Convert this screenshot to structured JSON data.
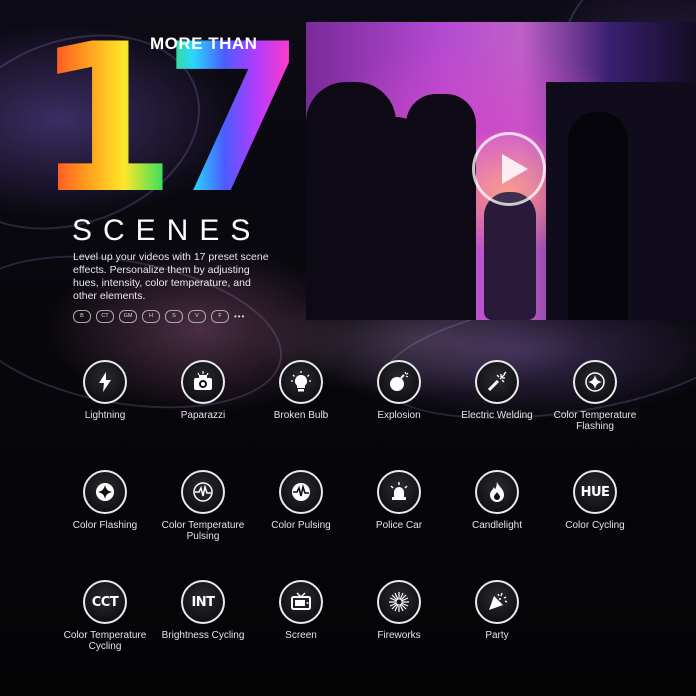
{
  "hero": {
    "more_than": "MORE THAN",
    "number": "17",
    "scenes": "SCENES",
    "description": "Level up your videos with 17 preset scene effects. Personalize them by adjusting hues, intensity, color temperature, and other elements."
  },
  "modes": [
    "B",
    "CT",
    "GM",
    "H",
    "S",
    "V",
    "F",
    "•••"
  ],
  "video": {
    "play_icon": "play-icon"
  },
  "effects": [
    {
      "label": "Lightning",
      "icon": "lightning-icon"
    },
    {
      "label": "Paparazzi",
      "icon": "camera-icon"
    },
    {
      "label": "Broken Bulb",
      "icon": "bulb-icon"
    },
    {
      "label": "Explosion",
      "icon": "bomb-icon"
    },
    {
      "label": "Electric Welding",
      "icon": "welding-icon"
    },
    {
      "label": "Color Temperature Flashing",
      "icon": "sparkle-icon"
    },
    {
      "label": "Color Flashing",
      "icon": "sparkle-filled-icon"
    },
    {
      "label": "Color Temperature Pulsing",
      "icon": "pulse-icon"
    },
    {
      "label": "Color Pulsing",
      "icon": "pulse-filled-icon"
    },
    {
      "label": "Police Car",
      "icon": "siren-icon"
    },
    {
      "label": "Candlelight",
      "icon": "flame-icon"
    },
    {
      "label": "Color Cycling",
      "icon_text": "HUE"
    },
    {
      "label": "Color Temperature Cycling",
      "icon_text": "CCT"
    },
    {
      "label": "Brightness Cycling",
      "icon_text": "INT"
    },
    {
      "label": "Screen",
      "icon": "tv-icon"
    },
    {
      "label": "Fireworks",
      "icon": "fireworks-icon"
    },
    {
      "label": "Party",
      "icon": "party-icon"
    }
  ],
  "colors": {
    "accent_gradient": [
      "#ff2a2a",
      "#ff9a1f",
      "#ffe62a",
      "#3ee05a",
      "#2ad6ff",
      "#4a5dff",
      "#b03cff",
      "#ff3cc8"
    ],
    "icon_ring": "#e9e9ee"
  }
}
